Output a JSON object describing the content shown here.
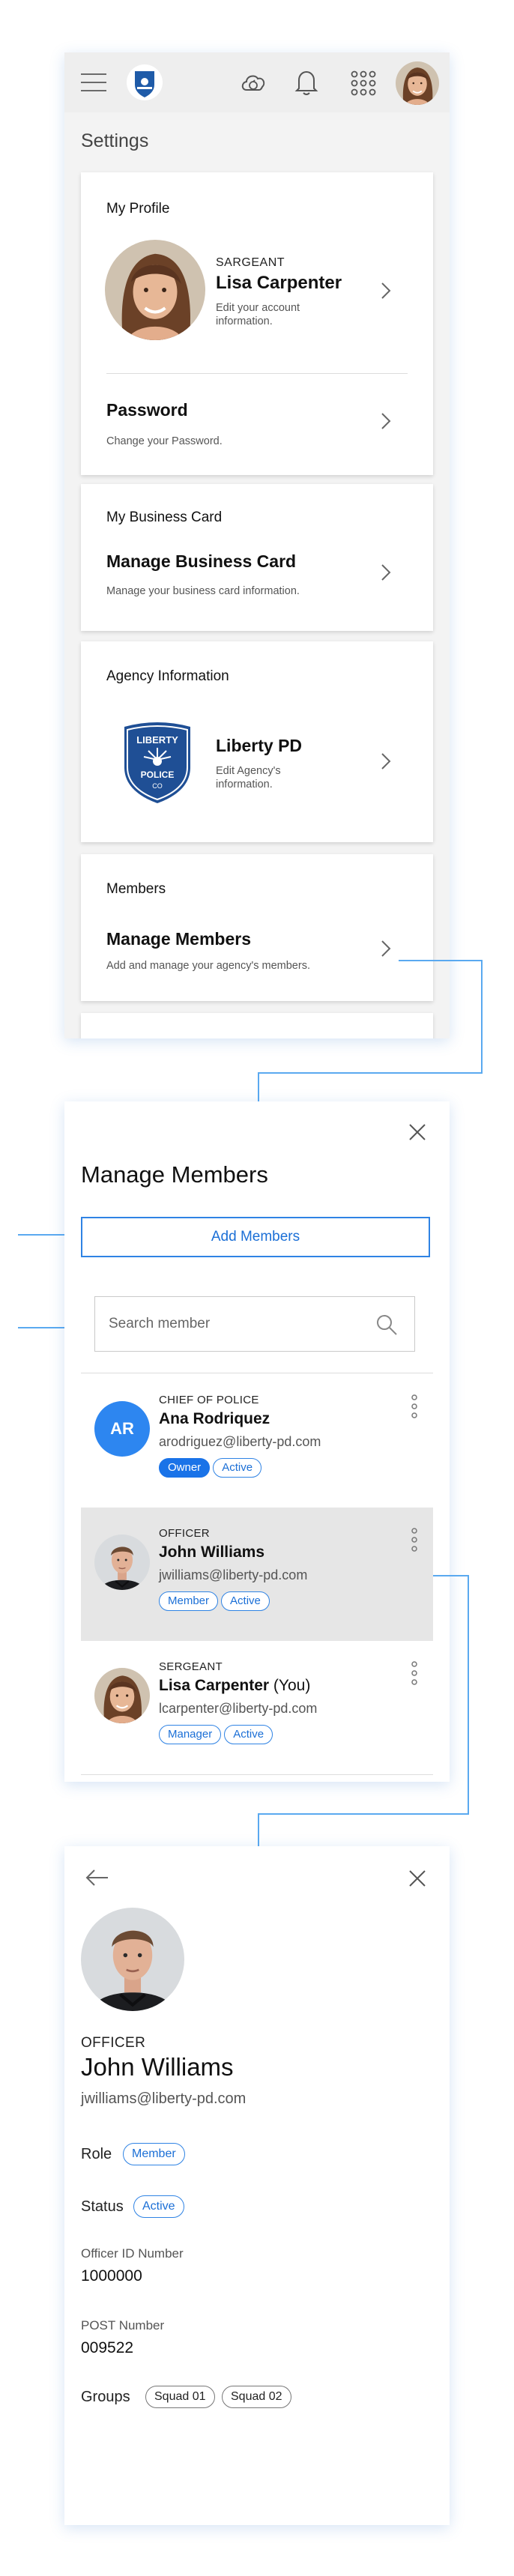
{
  "colors": {
    "accent": "#1a73e8",
    "connector": "#5aa9f0",
    "badge_border": "#2f83e4"
  },
  "icons": {
    "menu": "hamburger-icon",
    "logo": "liberty-badge-logo",
    "cloud": "cloud-sync-icon",
    "bell": "bell-icon",
    "apps": "grid-apps-icon",
    "chevron": "chevron-right-icon",
    "close": "close-icon",
    "search": "search-icon",
    "more": "more-vert-icon",
    "back": "arrow-back-icon"
  },
  "settings": {
    "title": "Settings",
    "profile": {
      "section": "My Profile",
      "rank": "SARGEANT",
      "name": "Lisa Carpenter",
      "desc": "Edit your account information."
    },
    "password": {
      "title": "Password",
      "desc": "Change your Password."
    },
    "business_card": {
      "section": "My Business Card",
      "title": "Manage Business Card",
      "desc": "Manage your business card information."
    },
    "agency": {
      "section": "Agency Information",
      "name": "Liberty PD",
      "desc": "Edit Agency's information.",
      "logo_text_top": "LIBERTY",
      "logo_text_mid": "POLICE",
      "logo_text_bottom": "CO"
    },
    "members": {
      "section": "Members",
      "title": "Manage Members",
      "desc": "Add and manage your agency's members."
    }
  },
  "manage_members": {
    "title": "Manage Members",
    "add_button": "Add Members",
    "search_placeholder": "Search member",
    "members": [
      {
        "rank": "CHIEF OF POLICE",
        "name": "Ana Rodriquez",
        "suffix": "",
        "email": "arodriguez@liberty-pd.com",
        "initials": "AR",
        "badges": [
          "Owner",
          "Active"
        ]
      },
      {
        "rank": "OFFICER",
        "name": "John Williams",
        "suffix": "",
        "email": "jwilliams@liberty-pd.com",
        "badges": [
          "Member",
          "Active"
        ]
      },
      {
        "rank": "SERGEANT",
        "name": "Lisa Carpenter",
        "suffix": " (You)",
        "email": "lcarpenter@liberty-pd.com",
        "badges": [
          "Manager",
          "Active"
        ]
      }
    ]
  },
  "member_detail": {
    "rank": "OFFICER",
    "name": "John Williams",
    "email": "jwilliams@liberty-pd.com",
    "role_label": "Role",
    "role": "Member",
    "status_label": "Status",
    "status": "Active",
    "officer_id_label": "Officer ID Number",
    "officer_id": "1000000",
    "post_label": "POST Number",
    "post": "009522",
    "groups_label": "Groups",
    "groups": [
      "Squad 01",
      "Squad 02"
    ]
  }
}
